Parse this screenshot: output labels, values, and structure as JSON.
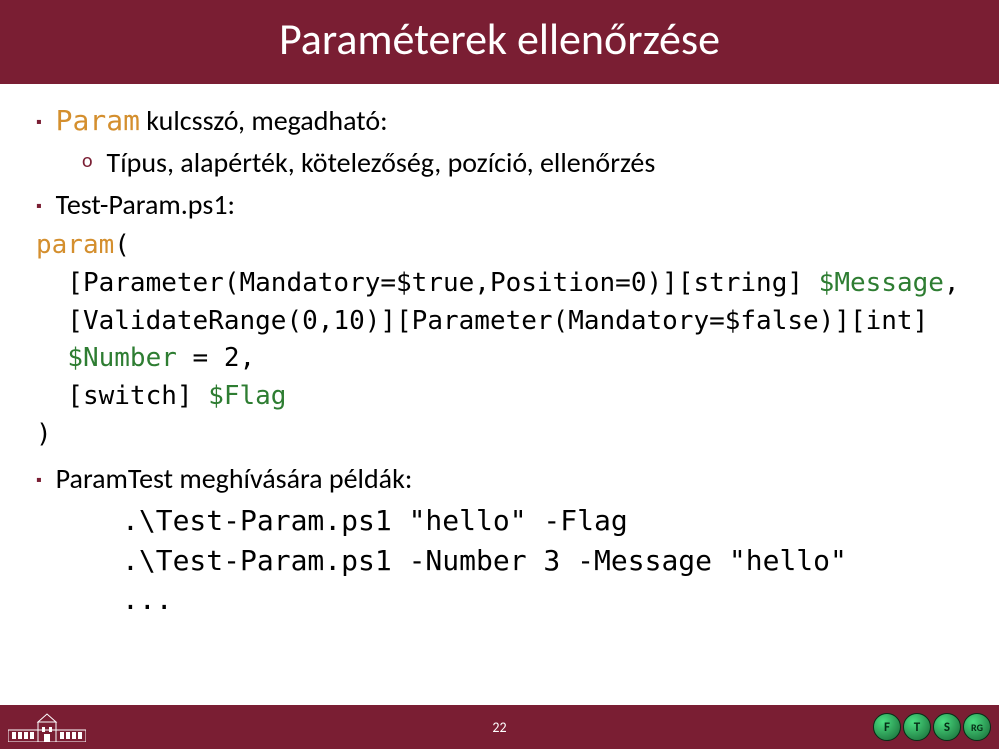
{
  "header": {
    "title": "Paraméterek ellenőrzése"
  },
  "bullets": {
    "b1_kw": "Param",
    "b1_rest": " kulcsszó, megadható:",
    "b1_sub": "Típus, alapérték, kötelezőség, pozíció, ellenőrzés",
    "b2": "Test-Param.ps1:",
    "b3": "ParamTest meghívására példák:"
  },
  "code": {
    "l1a": "param",
    "l1b": "(",
    "l2a": "  [Parameter(Mandatory=$true,Position=0)][string] ",
    "l2b": "$Message",
    "l2c": ",",
    "l3": "  [ValidateRange(0,10)][Parameter(Mandatory=$false)][int]",
    "l4a": "  ",
    "l4b": "$Number",
    "l4c": " = 2,",
    "l5a": "  [switch] ",
    "l5b": "$Flag",
    "l6": ")"
  },
  "examples": {
    "e1": ".\\Test-Param.ps1 \"hello\" -Flag",
    "e2": ".\\Test-Param.ps1 -Number 3 -Message \"hello\"",
    "e3": "..."
  },
  "footer": {
    "page": "22"
  },
  "orbs": {
    "o1": "F",
    "o2": "T",
    "o3": "S",
    "o4": "RG"
  }
}
